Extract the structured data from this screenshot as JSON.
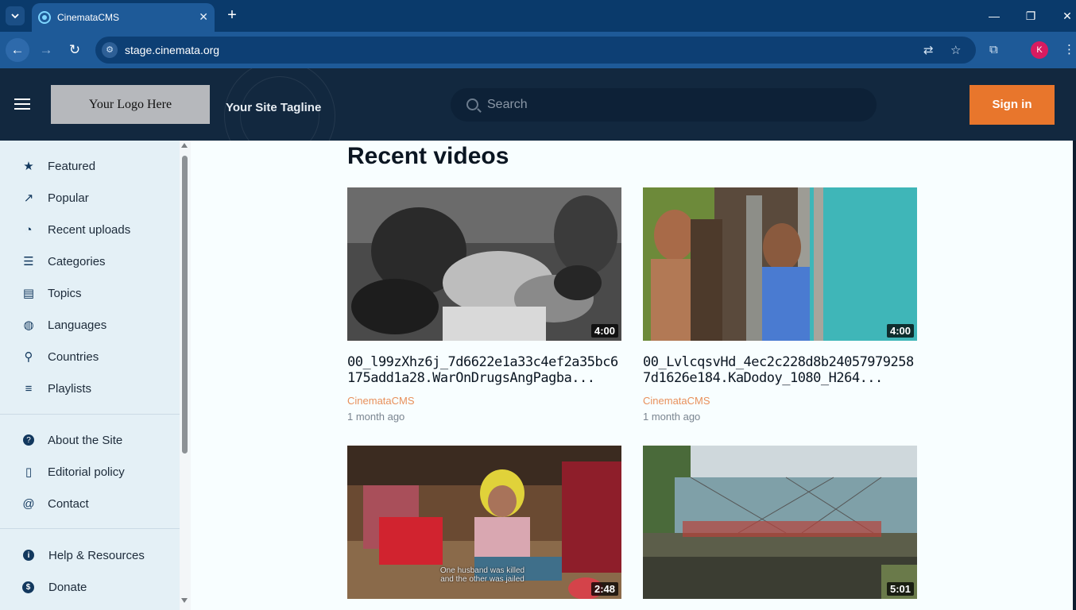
{
  "browser": {
    "tab_title": "CinemataCMS",
    "url": "stage.cinemata.org",
    "profile_initial": "K",
    "controls": {
      "close_tab": "✕",
      "new_tab": "+",
      "minimize": "—",
      "restore": "❐",
      "close": "✕",
      "back": "←",
      "forward": "→",
      "reload": "↻",
      "translate": "⇄",
      "bookmark": "☆",
      "extensions": "⧉",
      "menu": "⋮"
    }
  },
  "header": {
    "logo_text": "Your Logo Here",
    "tagline": "Your Site Tagline",
    "search_placeholder": "Search",
    "signin_label": "Sign in"
  },
  "sidebar": {
    "main_items": [
      {
        "label": "Featured",
        "icon": "star-icon",
        "glyph": "★"
      },
      {
        "label": "Popular",
        "icon": "trending-icon",
        "glyph": "↗"
      },
      {
        "label": "Recent uploads",
        "icon": "recent-icon",
        "glyph": "◔"
      },
      {
        "label": "Categories",
        "icon": "categories-icon",
        "glyph": "☰"
      },
      {
        "label": "Topics",
        "icon": "topics-icon",
        "glyph": "▤"
      },
      {
        "label": "Languages",
        "icon": "globe-icon",
        "glyph": "◍"
      },
      {
        "label": "Countries",
        "icon": "location-pin-icon",
        "glyph": "⚲"
      },
      {
        "label": "Playlists",
        "icon": "playlist-icon",
        "glyph": "≡"
      }
    ],
    "info_items": [
      {
        "label": "About the Site",
        "icon": "help-icon",
        "glyph": "?"
      },
      {
        "label": "Editorial policy",
        "icon": "document-icon",
        "glyph": "▯"
      },
      {
        "label": "Contact",
        "icon": "at-icon",
        "glyph": "@"
      }
    ],
    "support_items": [
      {
        "label": "Help & Resources",
        "icon": "info-icon",
        "glyph": "i"
      },
      {
        "label": "Donate",
        "icon": "dollar-icon",
        "glyph": "$"
      }
    ]
  },
  "main": {
    "title": "Recent videos",
    "videos": [
      {
        "title": "00_l99zXhz6j_7d6622e1a33c4ef2a35bc6175add1a28.WarOnDrugsAngPagba...",
        "author": "CinemataCMS",
        "time": "1 month ago",
        "duration": "4:00"
      },
      {
        "title": "00_LvlcqsvHd_4ec2c228d8b240579792587d1626e184.KaDodoy_1080_H264...",
        "author": "CinemataCMS",
        "time": "1 month ago",
        "duration": "4:00"
      },
      {
        "title": "",
        "author": "",
        "time": "",
        "duration": "2:48",
        "subtitle_line1": "One husband was killed",
        "subtitle_line2": "and the other was jailed"
      },
      {
        "title": "",
        "author": "",
        "time": "",
        "duration": "5:01"
      }
    ]
  }
}
